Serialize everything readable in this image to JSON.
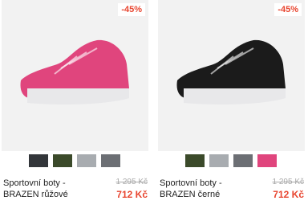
{
  "products": [
    {
      "badge": "-45%",
      "name": "Sportovní boty - BRAZEN růžové",
      "old_price": "1 295 Kč",
      "price": "712 Kč",
      "color": "#e0457d",
      "swatches": [
        "#33363a",
        "#3b4a2a",
        "#a8acb0",
        "#6c6f74"
      ]
    },
    {
      "badge": "-45%",
      "name": "Sportovní boty - BRAZEN černé",
      "old_price": "1 295 Kč",
      "price": "712 Kč",
      "color": "#1b1b1b",
      "swatches": [
        "#3b4a2a",
        "#a8acb0",
        "#6c6f74",
        "#e0457d"
      ]
    }
  ]
}
